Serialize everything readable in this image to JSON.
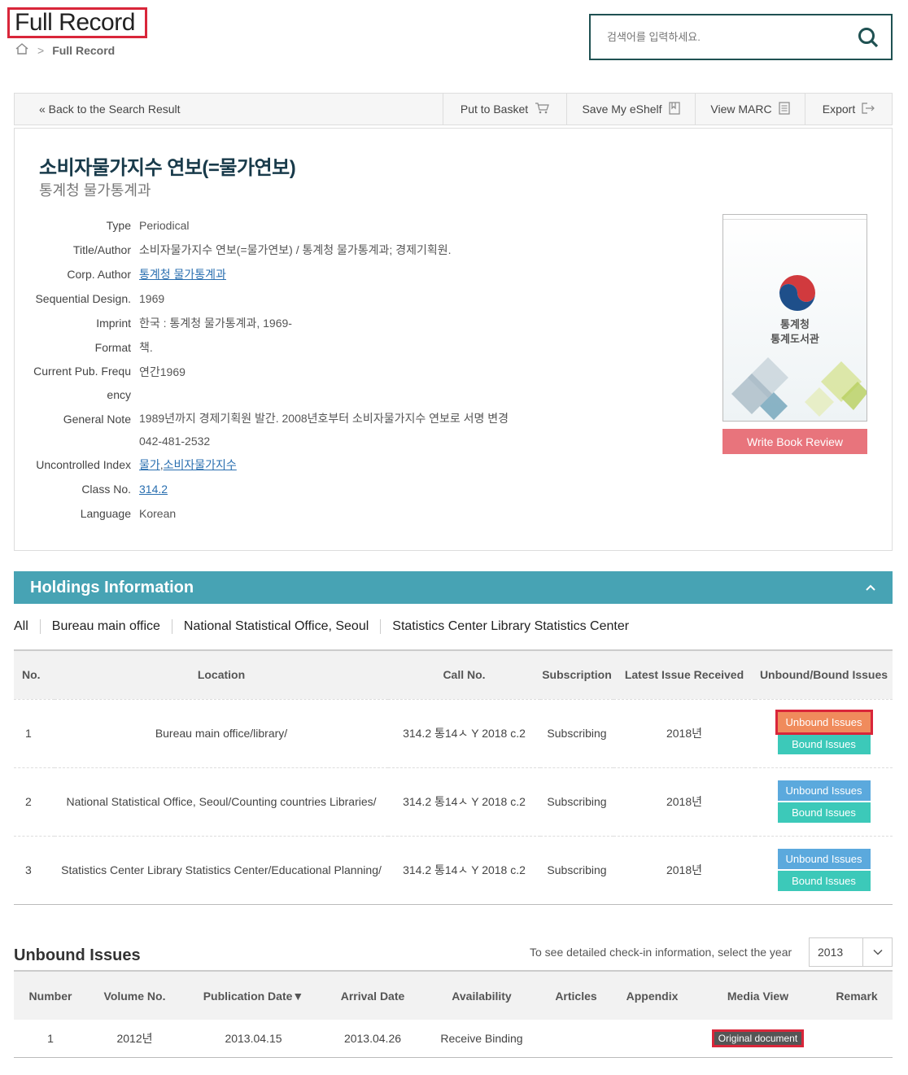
{
  "header": {
    "title": "Full Record",
    "breadcrumb_current": "Full Record",
    "search_placeholder": "검색어를 입력하세요."
  },
  "toolbar": {
    "back_label": "« Back to the Search Result",
    "basket_label": "Put to Basket",
    "eshelf_label": "Save My eShelf",
    "marc_label": "View MARC",
    "export_label": "Export"
  },
  "record": {
    "title": "소비자물가지수 연보(=물가연보)",
    "subtitle": "통계청 물가통계과",
    "fields": {
      "type_label": "Type",
      "type_value": "Periodical",
      "title_label": "Title/Author",
      "title_value": "소비자물가지수 연보(=물가연보) / 통계청 물가통계과; 경제기획원.",
      "corp_label": "Corp. Author",
      "corp_value": "통계청 물가통계과",
      "seq_label": "Sequential Design.",
      "seq_value": "1969",
      "imprint_label": "Imprint",
      "imprint_value": "한국 : 통계청 물가통계과, 1969-",
      "format_label": "Format",
      "format_value": "책.",
      "freq_label_1": "Current Pub. Frequ",
      "freq_label_2": "ency",
      "freq_value": "연간1969",
      "note_label": "General Note",
      "note_value_1": "1989년까지 경제기획원 발간. 2008년호부터 소비자물가지수 연보로 서명 변경",
      "note_value_2": "042-481-2532",
      "index_label": "Uncontrolled Index",
      "index_value_1": "물가",
      "index_value_2": "소비자물가지수",
      "class_label": "Class No.",
      "class_value": "314.2",
      "lang_label": "Language",
      "lang_value": "Korean"
    },
    "cover_text_1": "통계청",
    "cover_text_2": "통계도서관",
    "review_button": "Write Book Review"
  },
  "holdings": {
    "title": "Holdings Information",
    "filters": [
      "All",
      "Bureau main office",
      "National Statistical Office, Seoul",
      "Statistics Center Library Statistics Center"
    ],
    "columns": [
      "No.",
      "Location",
      "Call No.",
      "Subscription",
      "Latest Issue Received",
      "Unbound/Bound Issues"
    ],
    "unbound_label": "Unbound Issues",
    "bound_label": "Bound Issues",
    "rows": [
      {
        "no": "1",
        "location": "Bureau main office/library/",
        "call": "314.2 통14ㅅ Y 2018 c.2",
        "sub": "Subscribing",
        "latest": "2018년"
      },
      {
        "no": "2",
        "location": "National Statistical Office, Seoul/Counting countries Libraries/",
        "call": "314.2 통14ㅅ Y 2018 c.2",
        "sub": "Subscribing",
        "latest": "2018년"
      },
      {
        "no": "3",
        "location": "Statistics Center Library Statistics Center/Educational Planning/",
        "call": "314.2 통14ㅅ Y 2018 c.2",
        "sub": "Subscribing",
        "latest": "2018년"
      }
    ]
  },
  "unbound": {
    "title": "Unbound Issues",
    "year_hint": "To see detailed check-in information, select the year",
    "year_selected": "2013",
    "columns": [
      "Number",
      "Volume No.",
      "Publication Date▼",
      "Arrival Date",
      "Availability",
      "Articles",
      "Appendix",
      "Media View",
      "Remark"
    ],
    "rows": [
      {
        "number": "1",
        "volume": "2012년",
        "pub": "2013.04.15",
        "arrival": "2013.04.26",
        "avail": "Receive Binding",
        "articles": "",
        "appendix": "",
        "media": "Original document",
        "remark": ""
      }
    ]
  },
  "colors": {
    "accent_teal": "#47a3b4",
    "review_btn": "#e8747c",
    "highlight_red": "#d9263a"
  }
}
